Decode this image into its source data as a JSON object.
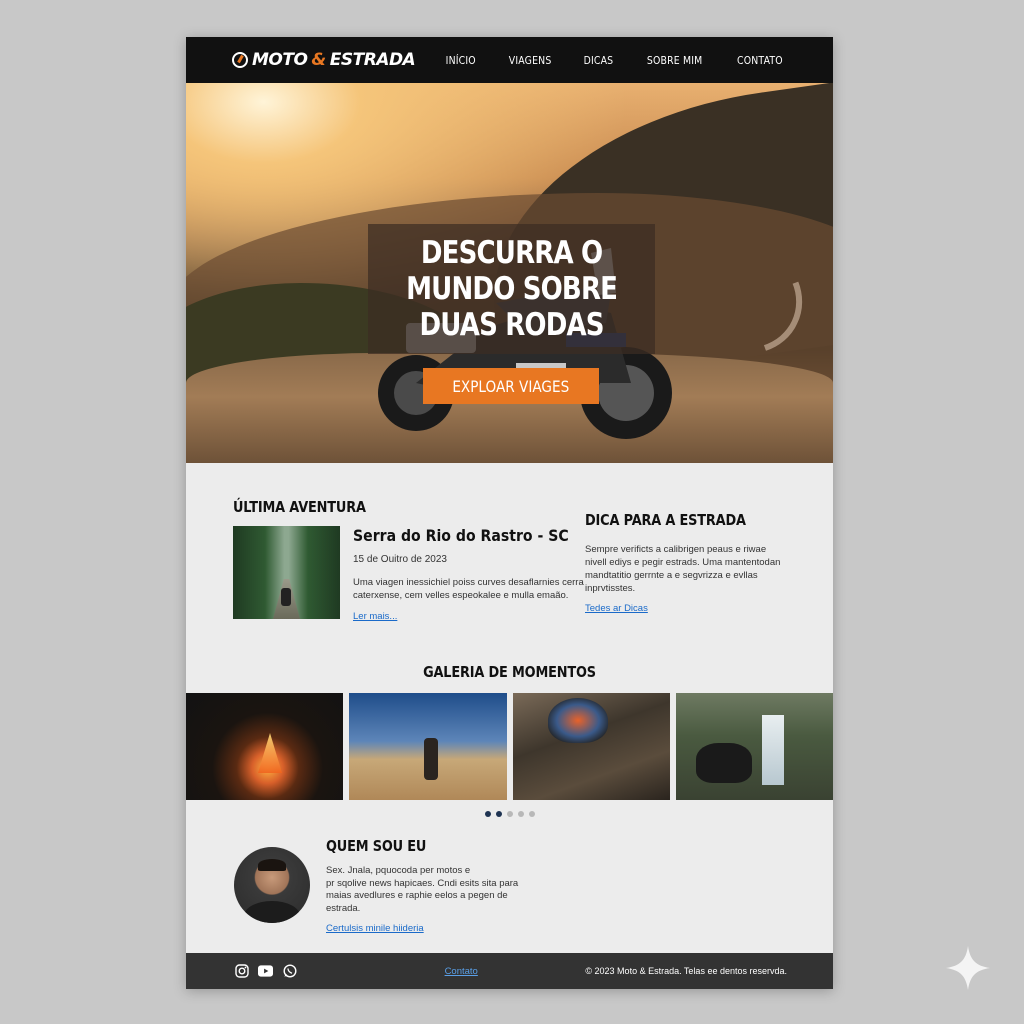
{
  "nav": {
    "logo_pre": "MOTO",
    "logo_amp": "&",
    "logo_post": "ESTRADA",
    "links": [
      "INÍCIO",
      "VIAGENS",
      "DICAS",
      "SOBRE MIM",
      "CONTATO"
    ]
  },
  "hero": {
    "title_lines": [
      "DESCURRA O",
      "MUNDO SOBRE",
      "DUAS RODAS"
    ],
    "button": "EXPLOAR VIAGES"
  },
  "adventure": {
    "heading": "ÚLTIMA AVENTURA",
    "title": "Serra do Rio do Rastro - SC",
    "date": "15 de Ouitro de 2023",
    "text": "Uma viagen inessichiel poiss curves desaflarnies cerra caterxense, cem velles espeokalee e mulla emaão.",
    "link": "Ler mais..."
  },
  "tip": {
    "heading": "DICA PARA A ESTRADA",
    "text": "Sempre verificts a calibrigen peaus e riwae nivell ediys e pegir estrads. Uma mantentodan mandtatitio gerrnte a e segvrizza e evllas inprvtisstes.",
    "link": "Tedes ar Dicas"
  },
  "gallery": {
    "heading": "GALERIA DE MOMENTOS",
    "images": [
      "campfire",
      "rider-desert-road",
      "helmet-gloves",
      "bike-waterfall"
    ],
    "dots_total": 5,
    "dots_active": 1
  },
  "about": {
    "heading": "QUEM SOU EU",
    "text_lines": [
      "Sex. Jnala, pquocoda per motos e",
      "pr sqolive news hapicaes. Cndi esits sita para",
      "maias avedlures e raphie eelos a pegen de estrada."
    ],
    "link": "Certulsis minile hiideria"
  },
  "footer": {
    "icons": [
      "instagram-icon",
      "youtube-icon",
      "whatsapp-icon"
    ],
    "link": "Contato",
    "copyright": "© 2023 Moto & Estrada. Telas ee dentos reservda."
  },
  "colors": {
    "accent": "#e87722",
    "nav_bg": "#111111",
    "link": "#1a6ac9",
    "footer_bg": "#333333"
  }
}
